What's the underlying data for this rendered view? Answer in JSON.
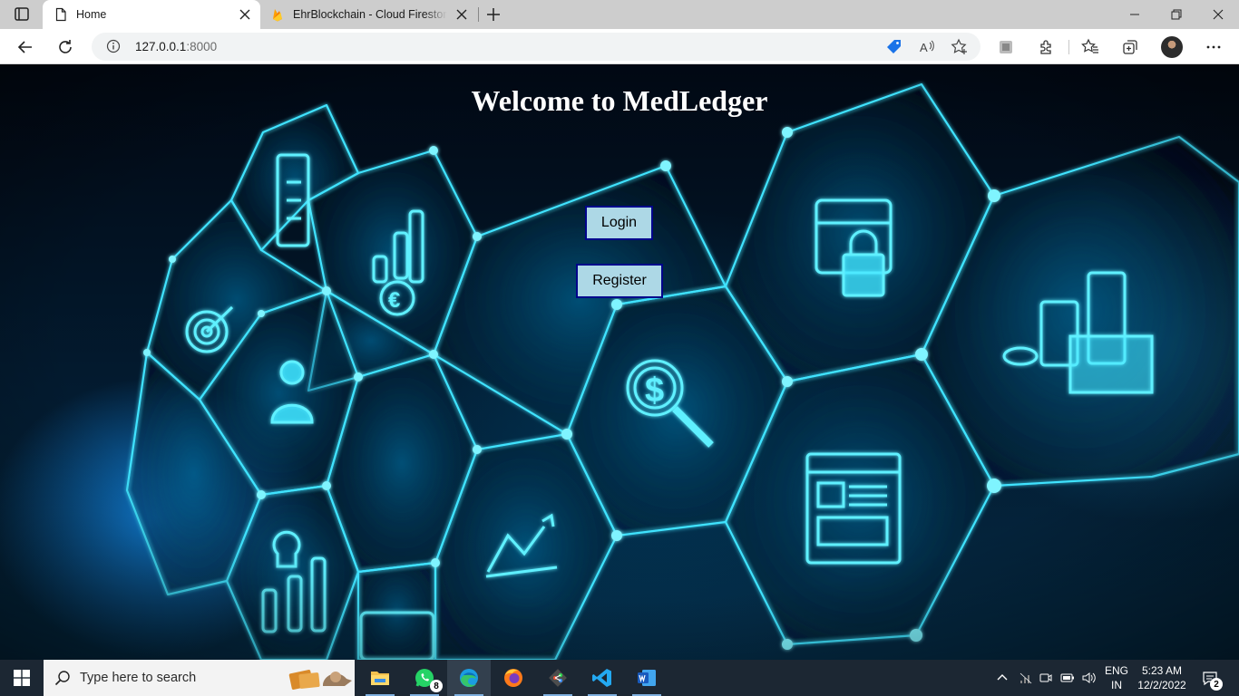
{
  "browser": {
    "tabs": [
      {
        "title": "Home",
        "favicon": "page-icon",
        "active": true
      },
      {
        "title": "EhrBlockchain - Cloud Firestore",
        "favicon": "firebase-icon",
        "active": false
      }
    ],
    "url_host": "127.0.0.1",
    "url_port": ":8000",
    "toolbar_icons": [
      "back-icon",
      "refresh-icon",
      "info-icon",
      "shopping-tag-icon",
      "read-aloud-icon",
      "add-favorite-icon",
      "collections-icon",
      "extensions-icon",
      "favorites-icon",
      "tab-actions-icon",
      "profile-avatar",
      "more-icon"
    ]
  },
  "page": {
    "title": "Welcome to MedLedger",
    "login_label": "Login",
    "register_label": "Register",
    "button_bg": "#add8e6",
    "button_border": "#00008b"
  },
  "taskbar": {
    "search_placeholder": "Type here to search",
    "apps": [
      "file-explorer-icon",
      "whatsapp-icon",
      "edge-icon",
      "firefox-icon",
      "git-icon",
      "vscode-icon",
      "word-icon"
    ],
    "whatsapp_badge": "8",
    "lang_line1": "ENG",
    "lang_line2": "IN",
    "time": "5:23 AM",
    "date": "12/2/2022",
    "notification_count": "2"
  }
}
